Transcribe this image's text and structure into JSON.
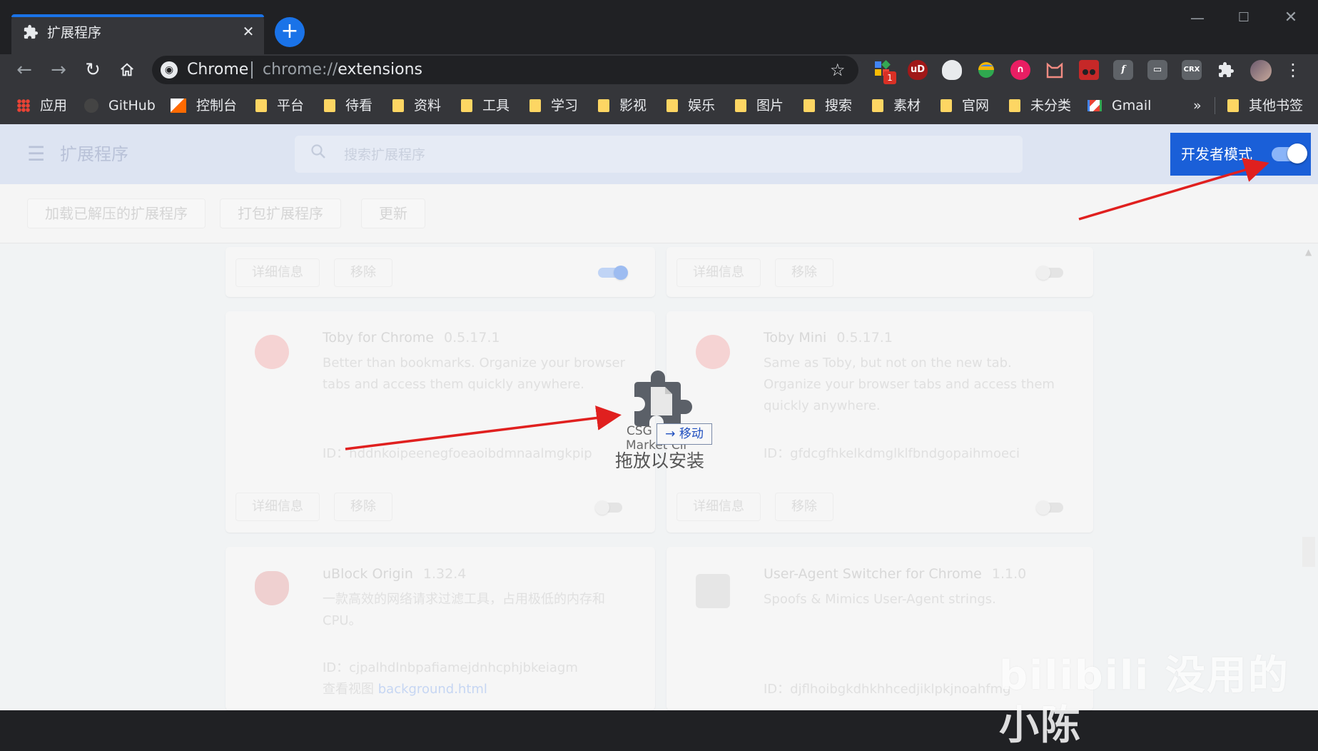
{
  "browser": {
    "tab_title": "扩展程序",
    "tab_close": "✕",
    "new_tab": "+",
    "omnibox": {
      "site_label": "Chrome",
      "url_scheme": "chrome://",
      "url_path": "extensions"
    },
    "extension_badge": "1",
    "extension_icons": [
      "ext-multicolor-icon",
      "ublock-icon",
      "shield-icon",
      "color-ball-icon",
      "n-logo-icon",
      "cat-icon",
      "tampermonkey-icon",
      "font-icon",
      "card-icon",
      "crx-icon",
      "puzzle-icon",
      "avatar"
    ],
    "ext_labels": {
      "ublock": "uD",
      "crx": "CRX",
      "font": "f"
    }
  },
  "bookmarks": [
    {
      "label": "应用",
      "type": "apps"
    },
    {
      "label": "GitHub",
      "type": "github"
    },
    {
      "label": "控制台",
      "type": "console"
    },
    {
      "label": "平台",
      "type": "folder"
    },
    {
      "label": "待看",
      "type": "folder"
    },
    {
      "label": "资料",
      "type": "folder"
    },
    {
      "label": "工具",
      "type": "folder"
    },
    {
      "label": "学习",
      "type": "folder"
    },
    {
      "label": "影视",
      "type": "folder"
    },
    {
      "label": "娱乐",
      "type": "folder"
    },
    {
      "label": "图片",
      "type": "folder"
    },
    {
      "label": "搜索",
      "type": "folder"
    },
    {
      "label": "素材",
      "type": "folder"
    },
    {
      "label": "官网",
      "type": "folder"
    },
    {
      "label": "未分类",
      "type": "folder"
    },
    {
      "label": "Gmail",
      "type": "gmail"
    }
  ],
  "bookmarks_overflow": "»",
  "other_bookmarks": "其他书签",
  "page": {
    "title": "扩展程序",
    "search_placeholder": "搜索扩展程序",
    "dev_mode_label": "开发者模式",
    "dev_mode_on": true,
    "actions": [
      "加载已解压的扩展程序",
      "打包扩展程序",
      "更新"
    ]
  },
  "cards": {
    "details_label": "详细信息",
    "remove_label": "移除",
    "id_prefix": "ID：",
    "top_row": [
      {
        "enabled": true
      },
      {
        "enabled": false
      }
    ],
    "items": [
      {
        "name": "Toby for Chrome",
        "version": "0.5.17.1",
        "description": "Better than bookmarks. Organize your browser tabs and access them quickly anywhere.",
        "id": "hddnkoipeenegfoeaoibdmnaalmgkpip",
        "enabled": false
      },
      {
        "name": "Toby Mini",
        "version": "0.5.17.1",
        "description": "Same as Toby, but not on the new tab. Organize your browser tabs and access them quickly anywhere.",
        "id": "gfdcgfhkelkdmglklfbndgopaihmoeci",
        "enabled": false
      },
      {
        "name": "uBlock Origin",
        "version": "1.32.4",
        "description": "一款高效的网络请求过滤工具，占用极低的内存和CPU。",
        "id": "cjpalhdlnbpafiamejdnhcphjbkeiagm",
        "inspect_label": "查看视图",
        "inspect_link": "background.html"
      },
      {
        "name": "User-Agent Switcher for Chrome",
        "version": "1.1.0",
        "description": "Spoofs & Mimics User-Agent strings.",
        "id": "djflhoibgkdhkhhcedjiklpkjnoahfmg"
      }
    ]
  },
  "drag": {
    "file_name_line1": "CSG",
    "file_name_line2": "Market Cli",
    "tooltip": "→ 移动",
    "hint": "拖放以安装"
  },
  "watermark": "bilibili 没用的小陈",
  "colors": {
    "accent": "#1a73e8",
    "dev_panel": "#1a5fd8",
    "arrow": "#e0201f",
    "tab_bg": "#35363a",
    "frame_bg": "#202124"
  }
}
